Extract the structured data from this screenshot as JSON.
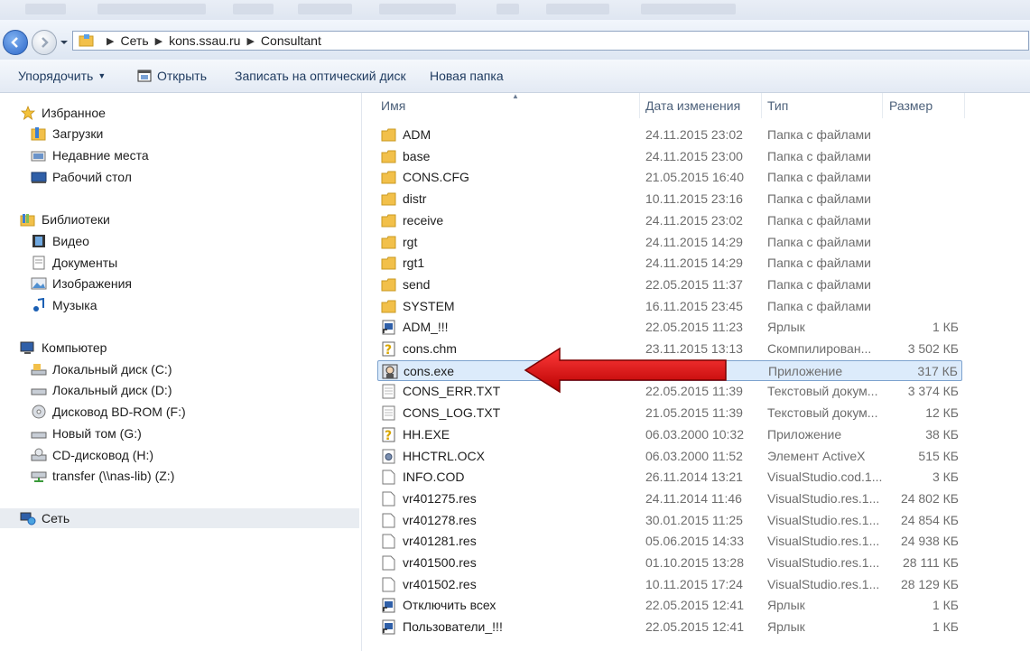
{
  "address": {
    "crumbs": [
      "Сеть",
      "kons.ssau.ru",
      "Consultant"
    ]
  },
  "toolbar": {
    "organize": "Упорядочить",
    "open": "Открыть",
    "burn": "Записать на оптический диск",
    "new_folder": "Новая папка"
  },
  "nav": {
    "favorites": "Избранное",
    "downloads": "Загрузки",
    "recent": "Недавние места",
    "desktop": "Рабочий стол",
    "libraries": "Библиотеки",
    "video": "Видео",
    "documents": "Документы",
    "images": "Изображения",
    "music": "Музыка",
    "computer": "Компьютер",
    "disk_c": "Локальный диск (C:)",
    "disk_d": "Локальный диск (D:)",
    "bd_rom": "Дисковод BD-ROM (F:)",
    "new_volume": "Новый том (G:)",
    "cd_drive": "CD-дисковод (H:)",
    "transfer": "transfer (\\\\nas-lib) (Z:)",
    "network": "Сеть"
  },
  "columns": {
    "name": "Имя",
    "date": "Дата изменения",
    "type": "Тип",
    "size": "Размер"
  },
  "files": [
    {
      "icon": "folder-icon",
      "name": "ADM",
      "date": "24.11.2015 23:02",
      "type": "Папка с файлами",
      "size": ""
    },
    {
      "icon": "folder-icon",
      "name": "base",
      "date": "24.11.2015 23:00",
      "type": "Папка с файлами",
      "size": ""
    },
    {
      "icon": "folder-icon",
      "name": "CONS.CFG",
      "date": "21.05.2015 16:40",
      "type": "Папка с файлами",
      "size": ""
    },
    {
      "icon": "folder-icon",
      "name": "distr",
      "date": "10.11.2015 23:16",
      "type": "Папка с файлами",
      "size": ""
    },
    {
      "icon": "folder-icon",
      "name": "receive",
      "date": "24.11.2015 23:02",
      "type": "Папка с файлами",
      "size": ""
    },
    {
      "icon": "folder-icon",
      "name": "rgt",
      "date": "24.11.2015 14:29",
      "type": "Папка с файлами",
      "size": ""
    },
    {
      "icon": "folder-icon",
      "name": "rgt1",
      "date": "24.11.2015 14:29",
      "type": "Папка с файлами",
      "size": ""
    },
    {
      "icon": "folder-icon",
      "name": "send",
      "date": "22.05.2015 11:37",
      "type": "Папка с файлами",
      "size": ""
    },
    {
      "icon": "folder-icon",
      "name": "SYSTEM",
      "date": "16.11.2015 23:45",
      "type": "Папка с файлами",
      "size": ""
    },
    {
      "icon": "shortcut-icon",
      "name": "ADM_!!!",
      "date": "22.05.2015 11:23",
      "type": "Ярлык",
      "size": "1 КБ"
    },
    {
      "icon": "help-file-icon",
      "name": "cons.chm",
      "date": "23.11.2015 13:13",
      "type": "Скомпилирован...",
      "size": "3 502 КБ"
    },
    {
      "icon": "exe-icon",
      "name": "cons.exe",
      "date": "…9",
      "type": "Приложение",
      "size": "317 КБ"
    },
    {
      "icon": "text-file-icon",
      "name": "CONS_ERR.TXT",
      "date": "22.05.2015 11:39",
      "type": "Текстовый докум...",
      "size": "3 374 КБ"
    },
    {
      "icon": "text-file-icon",
      "name": "CONS_LOG.TXT",
      "date": "21.05.2015 11:39",
      "type": "Текстовый докум...",
      "size": "12 КБ"
    },
    {
      "icon": "help-file-icon",
      "name": "HH.EXE",
      "date": "06.03.2000 10:32",
      "type": "Приложение",
      "size": "38 КБ"
    },
    {
      "icon": "activex-icon",
      "name": "HHCTRL.OCX",
      "date": "06.03.2000 11:52",
      "type": "Элемент ActiveX",
      "size": "515 КБ"
    },
    {
      "icon": "file-icon",
      "name": "INFO.COD",
      "date": "26.11.2014 13:21",
      "type": "VisualStudio.cod.1...",
      "size": "3 КБ"
    },
    {
      "icon": "file-icon",
      "name": "vr401275.res",
      "date": "24.11.2014 11:46",
      "type": "VisualStudio.res.1...",
      "size": "24 802 КБ"
    },
    {
      "icon": "file-icon",
      "name": "vr401278.res",
      "date": "30.01.2015 11:25",
      "type": "VisualStudio.res.1...",
      "size": "24 854 КБ"
    },
    {
      "icon": "file-icon",
      "name": "vr401281.res",
      "date": "05.06.2015 14:33",
      "type": "VisualStudio.res.1...",
      "size": "24 938 КБ"
    },
    {
      "icon": "file-icon",
      "name": "vr401500.res",
      "date": "01.10.2015 13:28",
      "type": "VisualStudio.res.1...",
      "size": "28 111 КБ"
    },
    {
      "icon": "file-icon",
      "name": "vr401502.res",
      "date": "10.11.2015 17:24",
      "type": "VisualStudio.res.1...",
      "size": "28 129 КБ"
    },
    {
      "icon": "shortcut-icon",
      "name": "Отключить всех",
      "date": "22.05.2015 12:41",
      "type": "Ярлык",
      "size": "1 КБ"
    },
    {
      "icon": "shortcut-icon",
      "name": "Пользователи_!!!",
      "date": "22.05.2015 12:41",
      "type": "Ярлык",
      "size": "1 КБ"
    }
  ],
  "selected_file": "cons.exe",
  "colors": {
    "arrow": "#e00000",
    "selection": "#dcebfb",
    "folder": "#f2c04a"
  }
}
